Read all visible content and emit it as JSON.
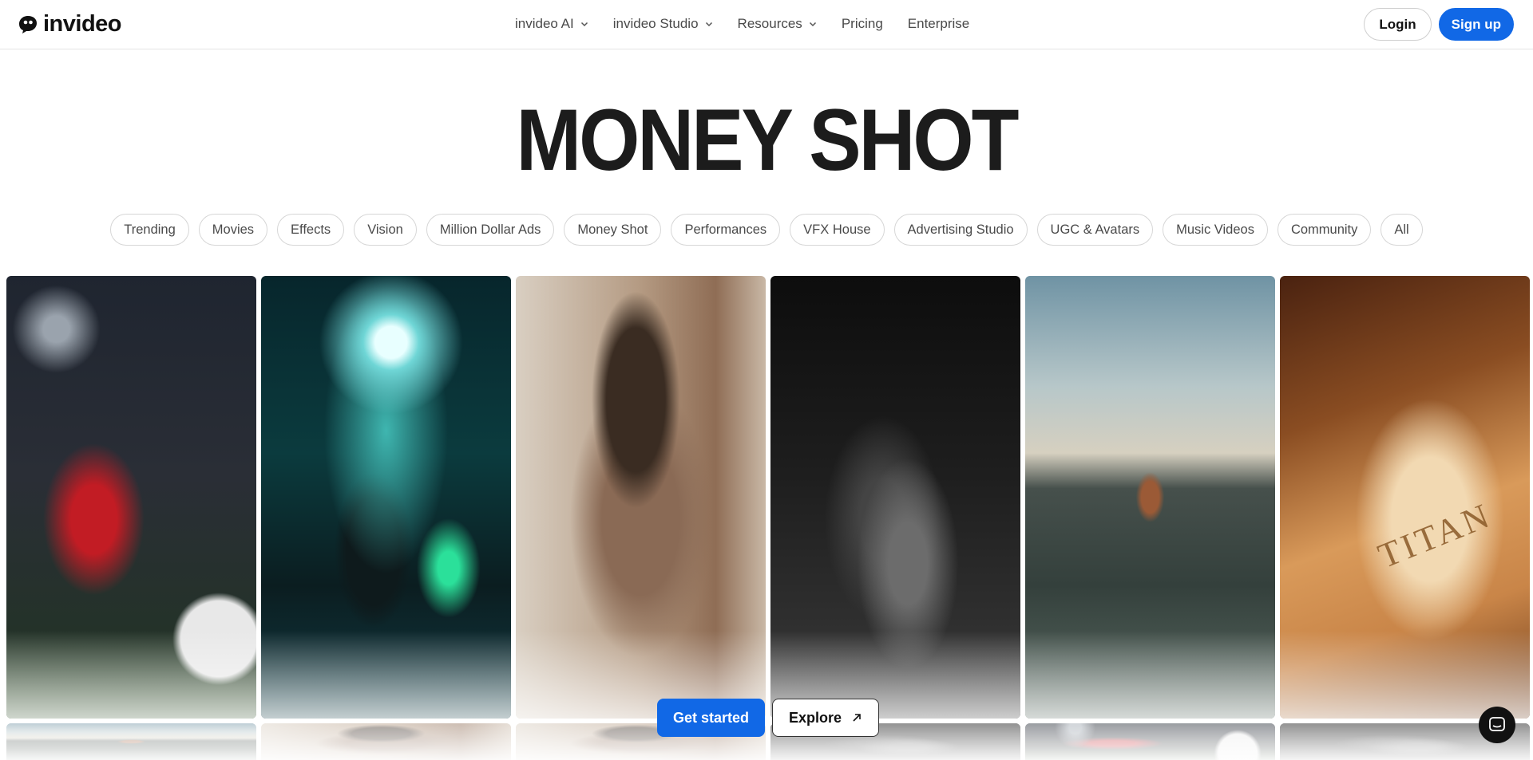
{
  "brand": {
    "name": "invideo"
  },
  "nav": {
    "items": [
      {
        "label": "invideo AI",
        "has_dropdown": true
      },
      {
        "label": "invideo Studio",
        "has_dropdown": true
      },
      {
        "label": "Resources",
        "has_dropdown": true
      },
      {
        "label": "Pricing",
        "has_dropdown": false
      },
      {
        "label": "Enterprise",
        "has_dropdown": false
      }
    ]
  },
  "auth": {
    "login_label": "Login",
    "signup_label": "Sign up"
  },
  "hero": {
    "title": "MONEY SHOT"
  },
  "categories": [
    "Trending",
    "Movies",
    "Effects",
    "Vision",
    "Million Dollar Ads",
    "Money Shot",
    "Performances",
    "VFX House",
    "Advertising Studio",
    "UGC & Avatars",
    "Music Videos",
    "Community",
    "All"
  ],
  "gallery": {
    "watermark_text": "TITAN"
  },
  "cta": {
    "start_label": "Get started",
    "explore_label": "Explore"
  },
  "colors": {
    "accent": "#1168e6",
    "text": "#1c1c1c",
    "chip_border": "#d6d6d6"
  },
  "icons": {
    "chat": "chat-bubble-icon",
    "explore": "arrow-up-right-icon",
    "dropdown": "chevron-down-icon"
  }
}
